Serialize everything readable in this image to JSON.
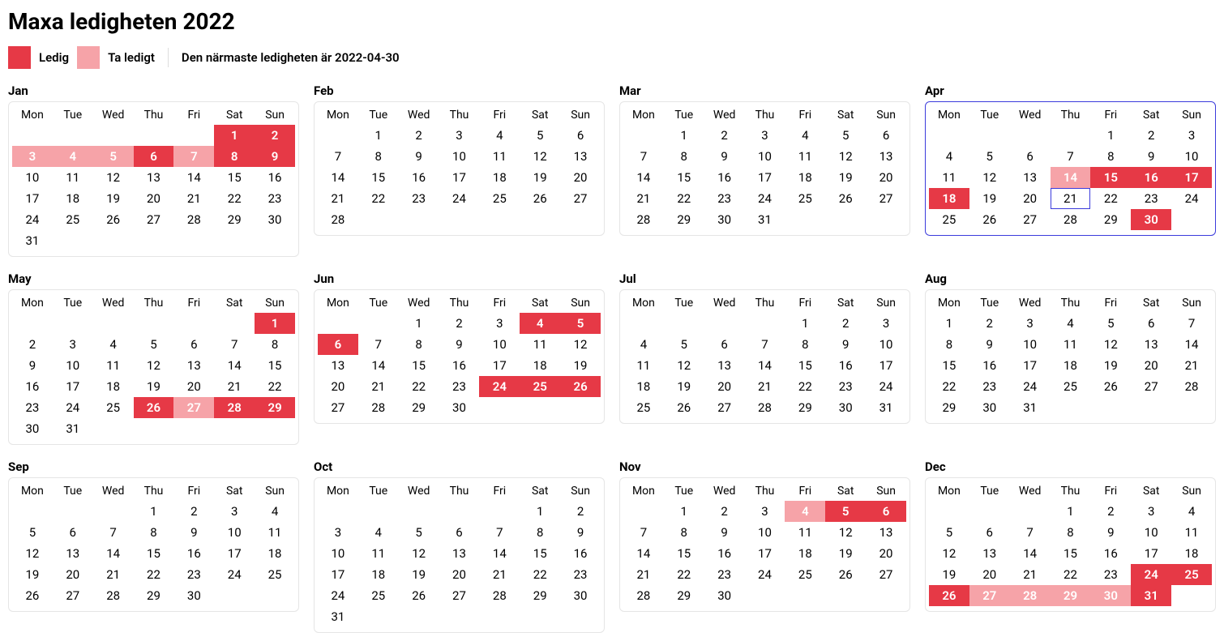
{
  "title": "Maxa ledigheten 2022",
  "legend": {
    "ledig_label": "Ledig",
    "ta_label": "Ta ledigt",
    "next_text": "Den närmaste ledigheten är 2022-04-30"
  },
  "colors": {
    "ledig": "#e63946",
    "ta": "#f6a3a8",
    "current_border": "#3b3bdc"
  },
  "dow": [
    "Mon",
    "Tue",
    "Wed",
    "Thu",
    "Fri",
    "Sat",
    "Sun"
  ],
  "today": "2022-04-21",
  "current_month": 4,
  "months": [
    {
      "name": "Jan",
      "offset": 5,
      "days": 31,
      "ledig": [
        1,
        2,
        6,
        8,
        9
      ],
      "ta": [
        3,
        4,
        5,
        7
      ]
    },
    {
      "name": "Feb",
      "offset": 1,
      "days": 28,
      "ledig": [],
      "ta": []
    },
    {
      "name": "Mar",
      "offset": 1,
      "days": 31,
      "ledig": [],
      "ta": []
    },
    {
      "name": "Apr",
      "offset": 4,
      "days": 30,
      "ledig": [
        15,
        16,
        17,
        18,
        30
      ],
      "ta": [
        14
      ]
    },
    {
      "name": "May",
      "offset": 6,
      "days": 31,
      "ledig": [
        1,
        26,
        28,
        29
      ],
      "ta": [
        27
      ]
    },
    {
      "name": "Jun",
      "offset": 2,
      "days": 30,
      "ledig": [
        4,
        5,
        6,
        24,
        25,
        26
      ],
      "ta": []
    },
    {
      "name": "Jul",
      "offset": 4,
      "days": 31,
      "ledig": [],
      "ta": []
    },
    {
      "name": "Aug",
      "offset": 0,
      "days": 31,
      "ledig": [],
      "ta": []
    },
    {
      "name": "Sep",
      "offset": 3,
      "days": 30,
      "ledig": [],
      "ta": []
    },
    {
      "name": "Oct",
      "offset": 5,
      "days": 31,
      "ledig": [],
      "ta": []
    },
    {
      "name": "Nov",
      "offset": 1,
      "days": 30,
      "ledig": [
        5,
        6
      ],
      "ta": [
        4
      ]
    },
    {
      "name": "Dec",
      "offset": 3,
      "days": 31,
      "ledig": [
        24,
        25,
        26,
        31
      ],
      "ta": [
        27,
        28,
        29,
        30
      ]
    }
  ]
}
